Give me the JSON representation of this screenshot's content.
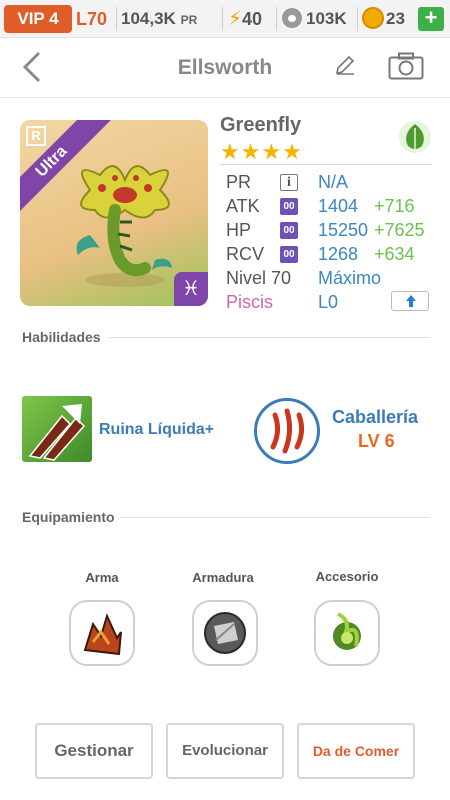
{
  "status": {
    "vip": "VIP 4",
    "level": "L70",
    "power": "104,3K",
    "power_unit": "PR",
    "energy": "40",
    "food": "103K",
    "coins": "23",
    "add": "+"
  },
  "header": {
    "title": "Ellsworth"
  },
  "monster": {
    "rarity_badge": "R",
    "ribbon": "Ultra",
    "zodiac_symbol": "♓",
    "species": "Greenfly",
    "stars": "★★★★",
    "element_icon": "leaf-icon"
  },
  "stats": {
    "pr_label": "PR",
    "pr_icon": "i",
    "pr_value": "N/A",
    "atk_label": "ATK",
    "atk_value": "1404",
    "atk_bonus": "+716",
    "hp_label": "HP",
    "hp_value": "15250",
    "hp_bonus": "+7625",
    "rcv_label": "RCV",
    "rcv_value": "1268",
    "rcv_bonus": "+634",
    "badge": "00",
    "level_label": "Nivel 70",
    "level_value": "Máximo",
    "zodiac_label": "Piscis",
    "zodiac_value": "L0"
  },
  "skills": {
    "title": "Habilidades",
    "skill1_name": "Ruina Líquida+",
    "skill2_name": "Caballería",
    "skill2_level": "LV 6"
  },
  "equipment": {
    "title": "Equipamiento",
    "weapon": "Arma",
    "armor": "Armadura",
    "accessory": "Accesorio"
  },
  "actions": {
    "manage": "Gestionar",
    "evolve": "Evolucionar",
    "feed": "Da de Comer"
  },
  "colors": {
    "accent_orange": "#e05d2a",
    "blue": "#3b86c6",
    "green": "#6bc44a",
    "purple": "#7f45a8"
  }
}
